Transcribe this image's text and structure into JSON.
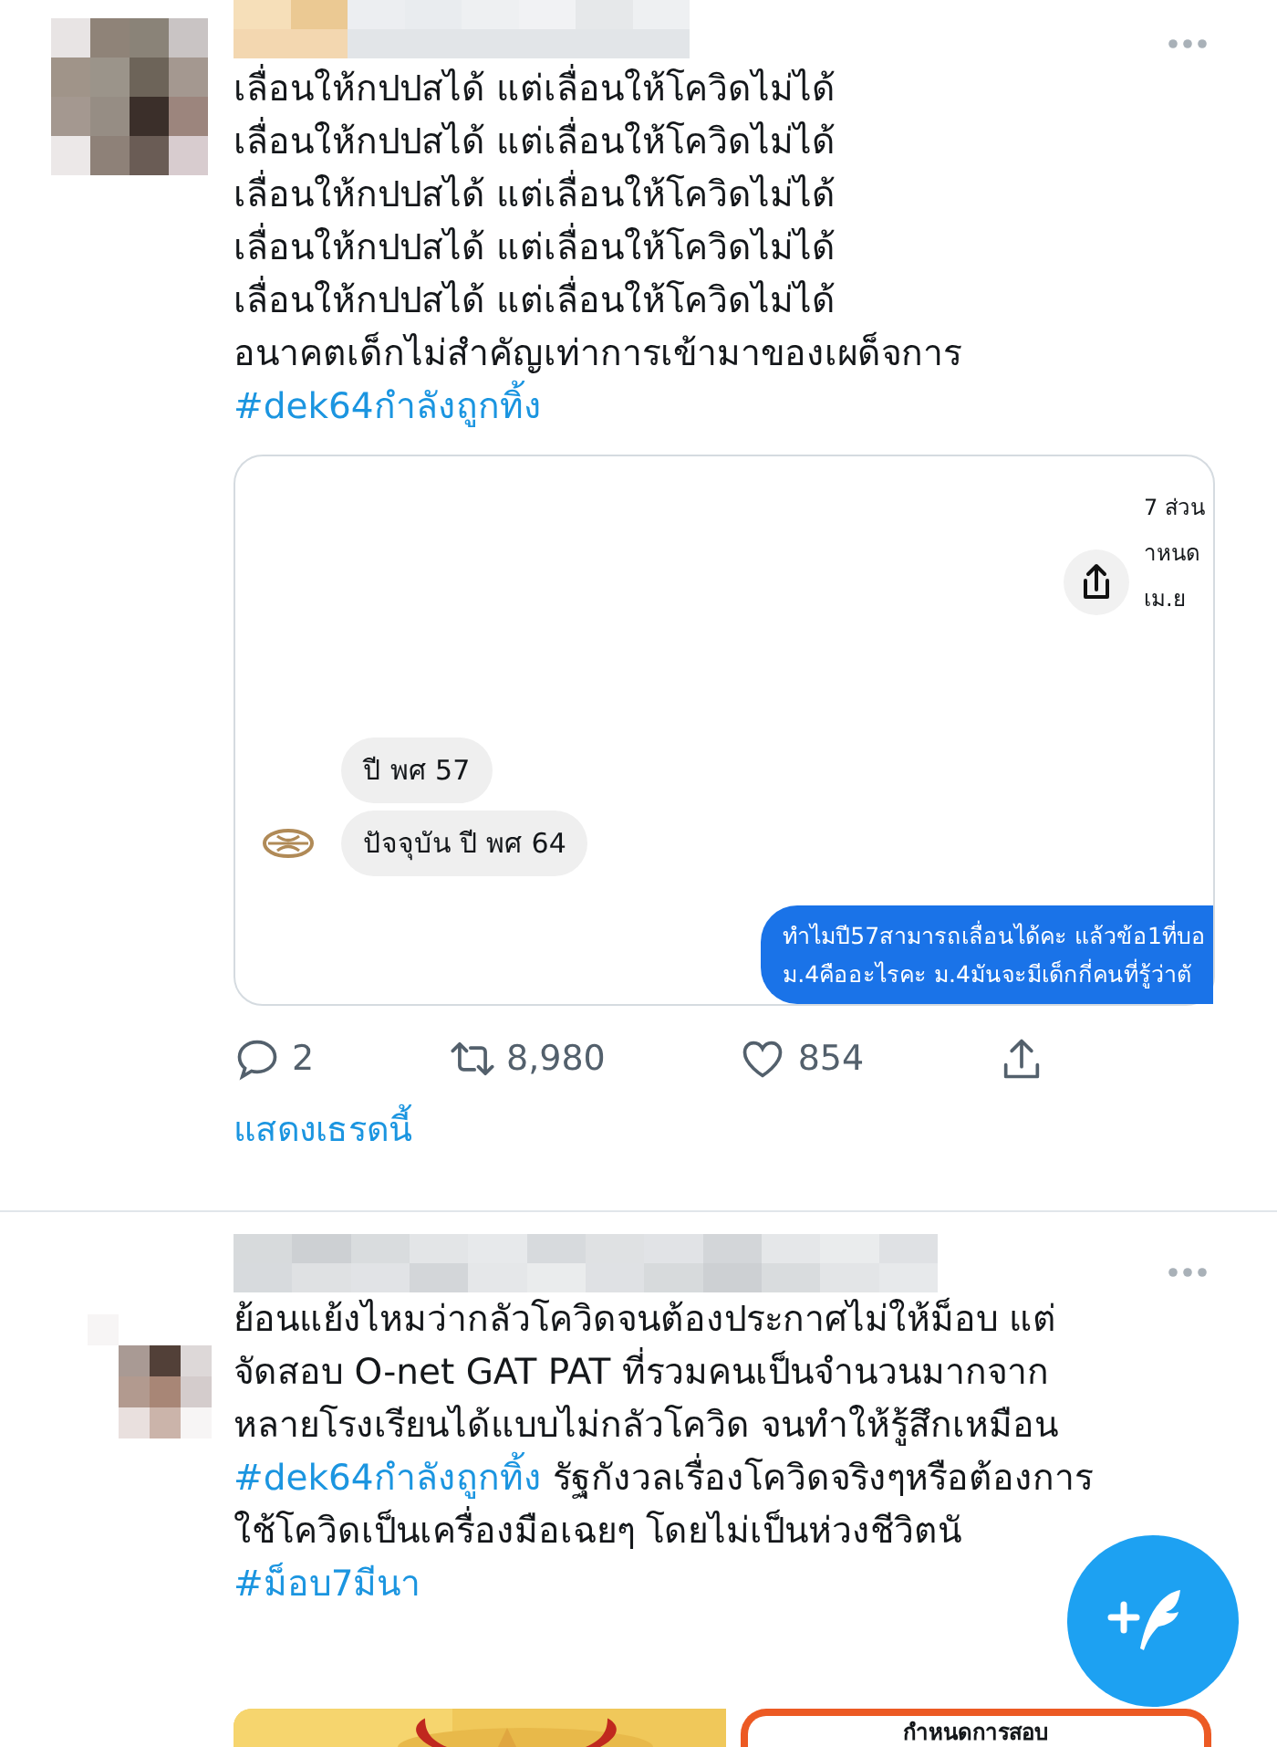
{
  "tweets": [
    {
      "lines": [
        [
          {
            "kind": "text",
            "text": "เลื่อนให้กปปสได้ แต่เลื่อนให้โควิดไม่ได้"
          }
        ],
        [
          {
            "kind": "text",
            "text": "เลื่อนให้กปปสได้ แต่เลื่อนให้โควิดไม่ได้"
          }
        ],
        [
          {
            "kind": "text",
            "text": "เลื่อนให้กปปสได้ แต่เลื่อนให้โควิดไม่ได้"
          }
        ],
        [
          {
            "kind": "text",
            "text": "เลื่อนให้กปปสได้ แต่เลื่อนให้โควิดไม่ได้"
          }
        ],
        [
          {
            "kind": "text",
            "text": "เลื่อนให้กปปสได้ แต่เลื่อนให้โควิดไม่ได้"
          }
        ],
        [
          {
            "kind": "text",
            "text": "อนาคตเด็กไม่สำคัญเท่าการเข้ามาของเผด็จการ"
          }
        ],
        [
          {
            "kind": "hashtag",
            "text": "#dek64กำลังถูกทิ้ง"
          }
        ]
      ],
      "media": {
        "kind": "chat",
        "side_texts": [
          "7 ส่วน",
          "าหนด",
          "เม.ย"
        ],
        "received": [
          "ปี พศ 57",
          "ปัจจุบัน ปี พศ 64"
        ],
        "sent": [
          "ทำไมปี57สามารถเลื่อนได้คะ แล้วข้อ1ที่บอ",
          "ม.4คืออะไรคะ ม.4มันจะมีเด็กกี่คนที่รู้ว่าตั"
        ]
      },
      "actions": {
        "replies": "2",
        "retweets": "8,980",
        "likes": "854"
      },
      "thread_link": "แสดงเธรดนี้"
    },
    {
      "lines": [
        [
          {
            "kind": "text",
            "text": "ย้อนแย้งไหมว่ากลัวโควิดจนต้องประกาศไม่ให้ม็อบ แต่"
          }
        ],
        [
          {
            "kind": "text",
            "text": "จัดสอบ O-net GAT PAT ที่รวมคนเป็นจำนวนมากจาก"
          }
        ],
        [
          {
            "kind": "text",
            "text": "หลายโรงเรียนได้แบบไม่กลัวโควิด จนทำให้รู้สึกเหมือน"
          }
        ],
        [
          {
            "kind": "hashtag",
            "text": "#dek64กำลังถูกทิ้ง"
          },
          {
            "kind": "text",
            "text": " รัฐกังวลเรื่องโควิดจริงๆหรือต้องการ"
          }
        ],
        [
          {
            "kind": "text",
            "text": "ใช้โควิดเป็นเครื่องมือเฉยๆ โดยไม่เป็นห่วงชีวิตนั"
          }
        ],
        [
          {
            "kind": "hashtag",
            "text": "#ม็อบ7มีนา"
          }
        ]
      ],
      "media": {
        "kind": "photos",
        "caption": "กำหนดการสอบ"
      }
    }
  ]
}
